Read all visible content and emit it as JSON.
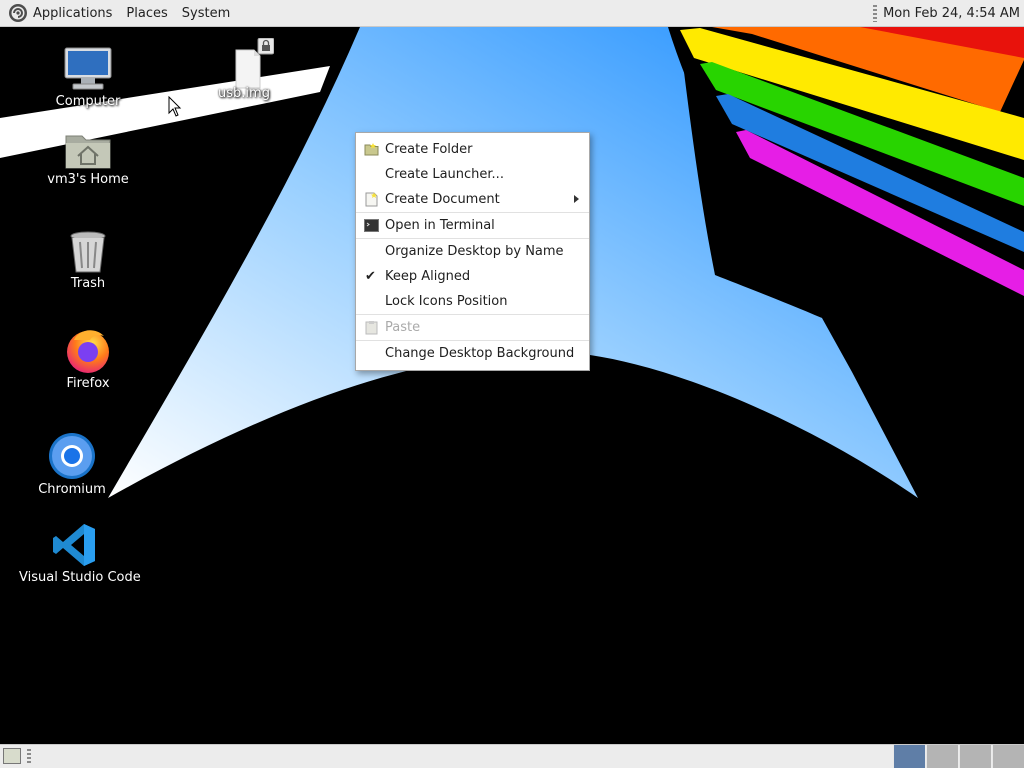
{
  "top_panel": {
    "menus": [
      "Applications",
      "Places",
      "System"
    ],
    "clock": "Mon Feb 24,  4:54 AM"
  },
  "desktop_icons": [
    {
      "label": "Computer",
      "icon": "computer-icon"
    },
    {
      "label": "usb.img",
      "icon": "file-icon"
    },
    {
      "label": "vm3's Home",
      "icon": "home-folder-icon"
    },
    {
      "label": "Trash",
      "icon": "trash-icon"
    },
    {
      "label": "Firefox",
      "icon": "firefox-icon"
    },
    {
      "label": "Chromium",
      "icon": "chromium-icon"
    },
    {
      "label": "Visual Studio Code",
      "icon": "vscode-icon"
    }
  ],
  "context_menu": {
    "items": [
      {
        "label": "Create Folder",
        "icon": "folder-icon"
      },
      {
        "label": "Create Launcher...",
        "icon": ""
      },
      {
        "label": "Create Document",
        "icon": "document-icon",
        "submenu": true
      },
      {
        "label": "Open in Terminal",
        "icon": "terminal-icon"
      },
      {
        "label": "Organize Desktop by Name",
        "icon": ""
      },
      {
        "label": "Keep Aligned",
        "checked": true
      },
      {
        "label": "Lock Icons Position",
        "icon": ""
      },
      {
        "label": "Paste",
        "icon": "paste-icon",
        "disabled": true
      },
      {
        "label": "Change Desktop Background",
        "icon": ""
      }
    ]
  },
  "bottom_panel": {
    "workspaces": 4,
    "active_workspace": 1
  },
  "colors": {
    "panel_bg": "#ececec",
    "wallpaper_blue": "#1a8cff",
    "active_workspace": "#5f7ea7"
  }
}
